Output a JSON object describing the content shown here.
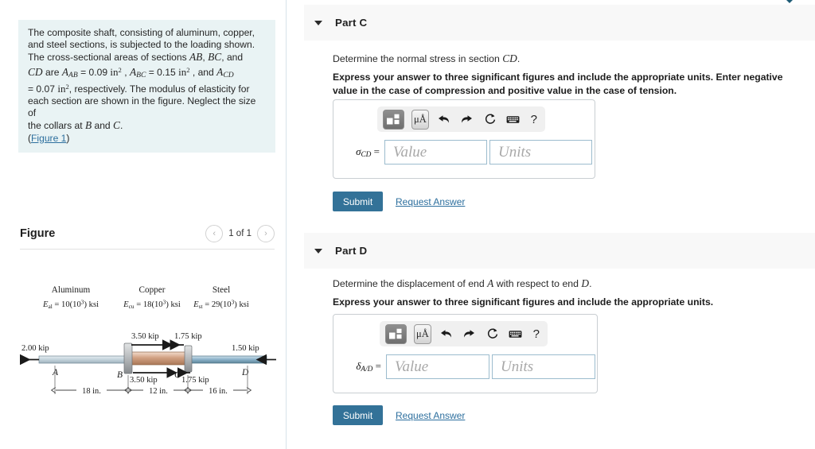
{
  "problem": {
    "line1": "The composite shaft, consisting of aluminum, copper,",
    "line2": "and steel sections, is subjected to the loading shown.",
    "line3_a": "The cross-sectional areas of sections ",
    "line3_AB": "AB",
    "line3_comma": ", ",
    "line3_BC": "BC",
    "line3_b": ", and",
    "line4_CD": "CD",
    "line4_a": " are ",
    "line4_A_AB": "A",
    "line4_sub_AB": "AB",
    "line4_eq1": " = 0.09 ",
    "line4_in": "in",
    "line4_sq": "2",
    "line4_comma": " , ",
    "line4_A_BC": "A",
    "line4_sub_BC": "BC",
    "line4_eq2": " = 0.15 ",
    "line4_and": " , and ",
    "line4_A_CD": "A",
    "line4_sub_CD": "CD",
    "line5_eq3": "= 0.07 ",
    "line5_rest": ", respectively. The modulus of elasticity for",
    "line6": "each section are shown in the figure. Neglect the size of",
    "line7_a": "the collars at ",
    "line7_B": "B",
    "line7_and": " and ",
    "line7_C": "C",
    "line7_period": ".",
    "figure_link": "Figure 1"
  },
  "figure": {
    "title": "Figure",
    "pager_prev": "‹",
    "pager_next": "›",
    "pager_count": "1 of 1",
    "materials": [
      {
        "name": "Aluminum",
        "symbol": "E",
        "sub": "al",
        "value": "= 10(10",
        "exp": "3",
        "unit": ") ksi"
      },
      {
        "name": "Copper",
        "symbol": "E",
        "sub": "cu",
        "value": "= 18(10",
        "exp": "3",
        "unit": ") ksi"
      },
      {
        "name": "Steel",
        "symbol": "E",
        "sub": "st",
        "value": "= 29(10",
        "exp": "3",
        "unit": ") ksi"
      }
    ],
    "loads": {
      "left": "2.00 kip",
      "top_mid": "3.50 kip",
      "top_right": "1.75 kip",
      "right": "1.50 kip",
      "bottom_mid": "3.50 kip",
      "bottom_right": "1.75 kip"
    },
    "points": {
      "a": "A",
      "b": "B",
      "c": "C",
      "d": "D"
    },
    "dims": {
      "ab": "18 in.",
      "bc": "12 in.",
      "cd": "16 in."
    },
    "colors": {
      "aluminum": "#c6d5dd",
      "copper": "#d2a183",
      "steel": "#8fb5cc",
      "collar": "#b9bcbe"
    }
  },
  "parts": [
    {
      "id": "part-c",
      "title": "Part C",
      "caret": "▼",
      "prompt_plain": "Determine the normal stress in section ",
      "prompt_math": "CD",
      "prompt_period": ".",
      "instruction": "Express your answer to three significant figures and include the appropriate units. Enter negative value in the case of compression and positive value in the case of tension.",
      "answer_symbol": "σ",
      "answer_sub": "CD",
      "answer_eq": " =",
      "value_placeholder": "Value",
      "units_placeholder": "Units",
      "value_current": "",
      "units_current": "",
      "submit_label": "Submit",
      "request_label": "Request Answer"
    },
    {
      "id": "part-d",
      "title": "Part D",
      "caret": "▼",
      "prompt_plain": "Determine the displacement of end ",
      "prompt_math": "A",
      "prompt_plain2": " with respect to end ",
      "prompt_math2": "D",
      "prompt_period": ".",
      "instruction": "Express your answer to three significant figures and include the appropriate units.",
      "answer_symbol": "δ",
      "answer_sub": "A/D",
      "answer_eq": " =",
      "value_placeholder": "Value",
      "units_placeholder": "Units",
      "value_current": "",
      "units_current": "",
      "submit_label": "Submit",
      "request_label": "Request Answer"
    }
  ],
  "toolbar": {
    "template_icon": "template-icon",
    "units_label": "μÅ",
    "undo_icon": "⬅",
    "redo_icon": "➡",
    "reset_icon": "↻",
    "keyboard_icon": "⌨",
    "help_label": "?"
  },
  "colors": {
    "accent": "#337298",
    "link": "#2d6f9e",
    "panel_bg": "#e9f3f4",
    "header_bg": "#f8f8f8",
    "input_border": "#9cbcce"
  }
}
